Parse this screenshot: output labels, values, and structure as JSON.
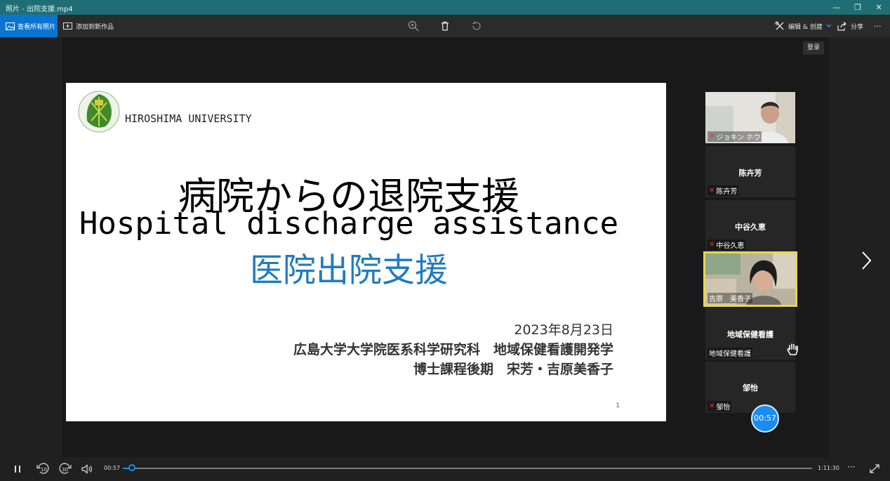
{
  "window": {
    "title": "照片 - 出院支援.mp4",
    "controls": [
      "—",
      "❐",
      "✕"
    ]
  },
  "toolbar": {
    "view_all_label": "查看所有照片",
    "add_to_creation_label": "添加到新作品",
    "edit_create_label": "编辑 & 创建",
    "share_label": "分享",
    "more_label": "···"
  },
  "overlay": {
    "login_label": "登录",
    "timer_badge": "00:57"
  },
  "slide": {
    "university": "HIROSHIMA UNIVERSITY",
    "title_ja": "病院からの退院支援",
    "title_en": "Hospital discharge assistance",
    "title_zh": "医院出院支援",
    "date": "2023年8月23日",
    "affiliation_line1": "広島大学大学院医系科学研究科　地域保健看護開発学",
    "affiliation_line2": "博士課程後期　宋芳・吉原美香子",
    "page_number": "1"
  },
  "participants": [
    {
      "label": "ジョキン ホウ",
      "center_name": "",
      "muted": true,
      "type": "video"
    },
    {
      "label": "陈卉芳",
      "center_name": "陈卉芳",
      "muted": true,
      "type": "name"
    },
    {
      "label": "中谷久恵",
      "center_name": "中谷久恵",
      "muted": true,
      "type": "name"
    },
    {
      "label": "吉原　美香子",
      "center_name": "",
      "muted": false,
      "type": "video",
      "active_speaker": true
    },
    {
      "label": "地域保健看護",
      "center_name": "地域保健看護",
      "muted": false,
      "type": "name",
      "hand_raised": true
    },
    {
      "label": "邹怡",
      "center_name": "邹怡",
      "muted": true,
      "type": "name"
    }
  ],
  "player": {
    "current_time": "00:57",
    "total_time": "1:11:30",
    "progress_fraction": 0.0133,
    "skip_back_label": "10",
    "skip_forward_label": "30"
  },
  "colors": {
    "titlebar": "#1f6e76",
    "accent": "#0b74d1",
    "slide_zh_title": "#1f7bc2",
    "active_speaker_border": "#e6d94a",
    "muted_mic": "#e0342b"
  }
}
